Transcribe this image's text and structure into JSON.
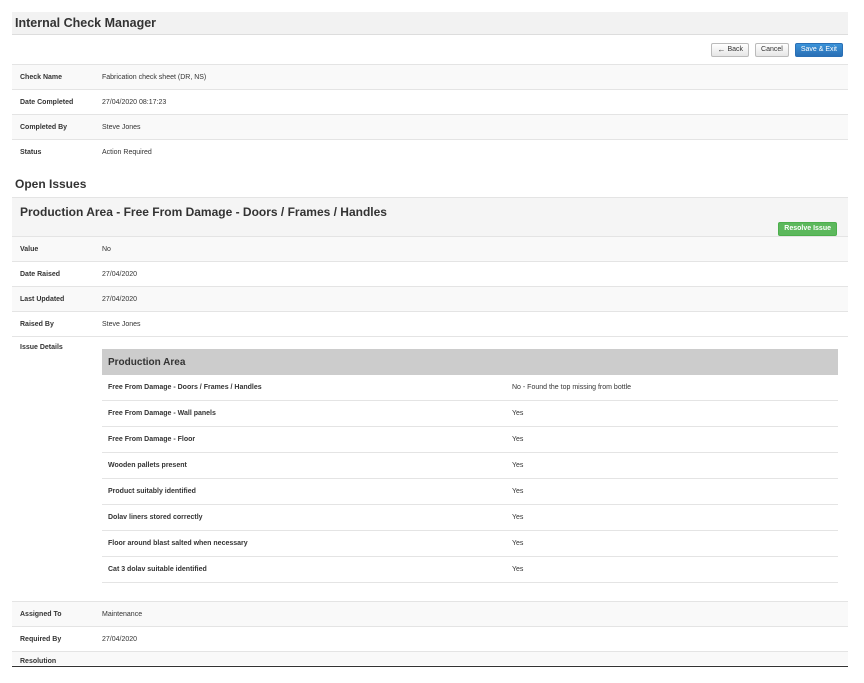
{
  "header": {
    "title": "Internal Check Manager"
  },
  "toolbar": {
    "back_label": "Back",
    "back_icon": "arrow-left-icon",
    "cancel_label": "Cancel",
    "save_exit_label": "Save & Exit"
  },
  "check": {
    "fields": [
      {
        "label": "Check Name",
        "value": "Fabrication check sheet (DR, NS)"
      },
      {
        "label": "Date Completed",
        "value": "27/04/2020 08:17:23"
      },
      {
        "label": "Completed By",
        "value": "Steve Jones"
      },
      {
        "label": "Status",
        "value": "Action Required"
      }
    ]
  },
  "open_issues": {
    "heading": "Open Issues",
    "issue": {
      "title": "Production Area - Free From Damage - Doors / Frames / Handles",
      "resolve_label": "Resolve Issue",
      "fields": [
        {
          "label": "Value",
          "value": "No"
        },
        {
          "label": "Date Raised",
          "value": "27/04/2020"
        },
        {
          "label": "Last Updated",
          "value": "27/04/2020"
        },
        {
          "label": "Raised By",
          "value": "Steve Jones"
        }
      ],
      "details_label": "Issue Details",
      "details": {
        "section": "Production Area",
        "rows": [
          {
            "question": "Free From Damage - Doors / Frames / Handles",
            "answer": "No - Found the top missing from bottle"
          },
          {
            "question": "Free From Damage - Wall panels",
            "answer": "Yes"
          },
          {
            "question": "Free From Damage - Floor",
            "answer": "Yes"
          },
          {
            "question": "Wooden pallets present",
            "answer": "Yes"
          },
          {
            "question": "Product suitably identified",
            "answer": "Yes"
          },
          {
            "question": "Dolav liners stored correctly",
            "answer": "Yes"
          },
          {
            "question": "Floor around blast salted when necessary",
            "answer": "Yes"
          },
          {
            "question": "Cat 3 dolav suitable identified",
            "answer": "Yes"
          }
        ]
      },
      "after_fields": [
        {
          "label": "Assigned To",
          "value": "Maintenance"
        },
        {
          "label": "Required By",
          "value": "27/04/2020"
        },
        {
          "label": "Resolution",
          "value": ""
        }
      ]
    }
  },
  "colors": {
    "primary": "#2a6fb5",
    "success": "#5cb85c",
    "header_bg": "#f2f2f2",
    "section_bg": "#cccccc"
  }
}
